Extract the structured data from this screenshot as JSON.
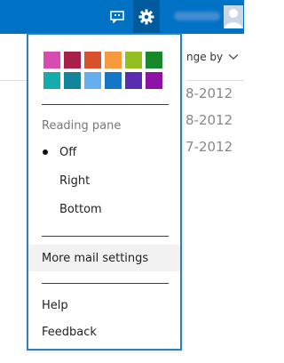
{
  "colors": {
    "accent": "#0072c6"
  },
  "topbar": {
    "chat_icon": "chat-icon",
    "settings_icon": "gear-icon",
    "avatar_icon": "person-icon"
  },
  "background": {
    "arrange_label": "nge by",
    "dates": [
      "8-2012",
      "8-2012",
      "7-2012"
    ]
  },
  "menu": {
    "swatches": [
      "#d84bb0",
      "#a8204a",
      "#d8502c",
      "#f79a3e",
      "#93c020",
      "#17892c",
      "#14acac",
      "#138499",
      "#66aef0",
      "#1576c5",
      "#5b2cb1",
      "#8f12a6"
    ],
    "reading_pane_label": "Reading pane",
    "reading_pane_options": [
      {
        "label": "Off",
        "selected": true
      },
      {
        "label": "Right",
        "selected": false
      },
      {
        "label": "Bottom",
        "selected": false
      }
    ],
    "more_settings": "More mail settings",
    "help": "Help",
    "feedback": "Feedback"
  }
}
